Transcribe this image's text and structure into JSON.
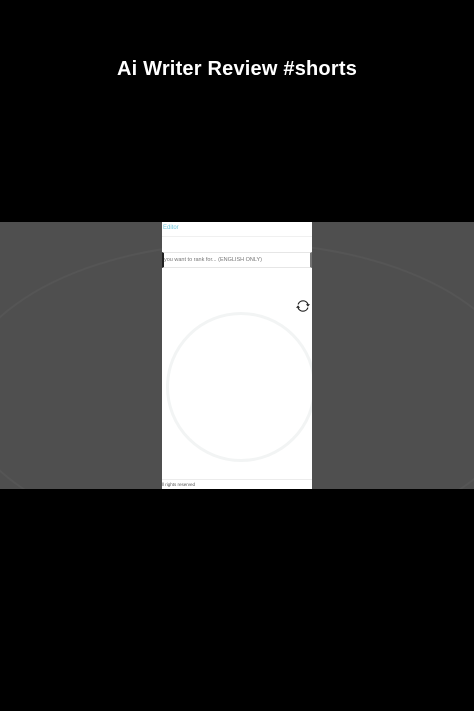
{
  "video": {
    "title": "Ai Writer Review #shorts"
  },
  "app": {
    "header_label": "Editor",
    "input_placeholder": "you want to rank for... (ENGLISH ONLY)",
    "footer_text": "ll rights reserved",
    "refresh_icon": "refresh-icon",
    "accent_color": "#6fc6dd"
  }
}
